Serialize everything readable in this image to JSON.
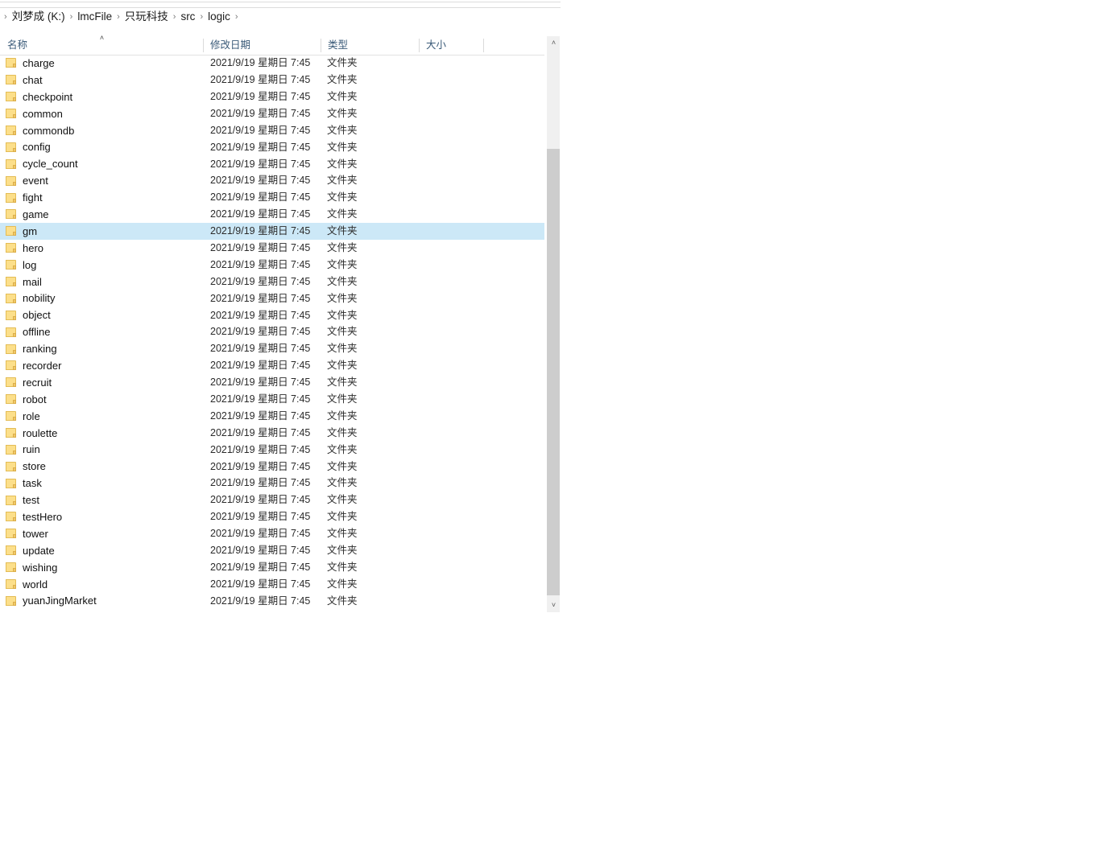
{
  "window": {
    "app": "File Explorer"
  },
  "addressbar": {
    "leading_separator": "›",
    "separator": "›",
    "crumbs": [
      "刘梦成 (K:)",
      "lmcFile",
      "只玩科技",
      "src",
      "logic"
    ]
  },
  "columns": {
    "sort_indicator": "˄",
    "headers": [
      {
        "label": "名称",
        "key": "name"
      },
      {
        "label": "修改日期",
        "key": "date"
      },
      {
        "label": "类型",
        "key": "type"
      },
      {
        "label": "大小",
        "key": "size"
      }
    ]
  },
  "colors": {
    "selection": "#cce8f7",
    "folder_fill": "#fcdf8a",
    "header_text": "#3a5a78"
  },
  "scrollbar": {
    "up_arrow": "˄",
    "down_arrow": "˅"
  },
  "rows": [
    {
      "name": "charge",
      "date": "2021/9/19 星期日 7:45",
      "type": "文件夹",
      "size": "",
      "selected": false
    },
    {
      "name": "chat",
      "date": "2021/9/19 星期日 7:45",
      "type": "文件夹",
      "size": "",
      "selected": false
    },
    {
      "name": "checkpoint",
      "date": "2021/9/19 星期日 7:45",
      "type": "文件夹",
      "size": "",
      "selected": false
    },
    {
      "name": "common",
      "date": "2021/9/19 星期日 7:45",
      "type": "文件夹",
      "size": "",
      "selected": false
    },
    {
      "name": "commondb",
      "date": "2021/9/19 星期日 7:45",
      "type": "文件夹",
      "size": "",
      "selected": false
    },
    {
      "name": "config",
      "date": "2021/9/19 星期日 7:45",
      "type": "文件夹",
      "size": "",
      "selected": false
    },
    {
      "name": "cycle_count",
      "date": "2021/9/19 星期日 7:45",
      "type": "文件夹",
      "size": "",
      "selected": false
    },
    {
      "name": "event",
      "date": "2021/9/19 星期日 7:45",
      "type": "文件夹",
      "size": "",
      "selected": false
    },
    {
      "name": "fight",
      "date": "2021/9/19 星期日 7:45",
      "type": "文件夹",
      "size": "",
      "selected": false
    },
    {
      "name": "game",
      "date": "2021/9/19 星期日 7:45",
      "type": "文件夹",
      "size": "",
      "selected": false
    },
    {
      "name": "gm",
      "date": "2021/9/19 星期日 7:45",
      "type": "文件夹",
      "size": "",
      "selected": true
    },
    {
      "name": "hero",
      "date": "2021/9/19 星期日 7:45",
      "type": "文件夹",
      "size": "",
      "selected": false
    },
    {
      "name": "log",
      "date": "2021/9/19 星期日 7:45",
      "type": "文件夹",
      "size": "",
      "selected": false
    },
    {
      "name": "mail",
      "date": "2021/9/19 星期日 7:45",
      "type": "文件夹",
      "size": "",
      "selected": false
    },
    {
      "name": "nobility",
      "date": "2021/9/19 星期日 7:45",
      "type": "文件夹",
      "size": "",
      "selected": false
    },
    {
      "name": "object",
      "date": "2021/9/19 星期日 7:45",
      "type": "文件夹",
      "size": "",
      "selected": false
    },
    {
      "name": "offline",
      "date": "2021/9/19 星期日 7:45",
      "type": "文件夹",
      "size": "",
      "selected": false
    },
    {
      "name": "ranking",
      "date": "2021/9/19 星期日 7:45",
      "type": "文件夹",
      "size": "",
      "selected": false
    },
    {
      "name": "recorder",
      "date": "2021/9/19 星期日 7:45",
      "type": "文件夹",
      "size": "",
      "selected": false
    },
    {
      "name": "recruit",
      "date": "2021/9/19 星期日 7:45",
      "type": "文件夹",
      "size": "",
      "selected": false
    },
    {
      "name": "robot",
      "date": "2021/9/19 星期日 7:45",
      "type": "文件夹",
      "size": "",
      "selected": false
    },
    {
      "name": "role",
      "date": "2021/9/19 星期日 7:45",
      "type": "文件夹",
      "size": "",
      "selected": false
    },
    {
      "name": "roulette",
      "date": "2021/9/19 星期日 7:45",
      "type": "文件夹",
      "size": "",
      "selected": false
    },
    {
      "name": "ruin",
      "date": "2021/9/19 星期日 7:45",
      "type": "文件夹",
      "size": "",
      "selected": false
    },
    {
      "name": "store",
      "date": "2021/9/19 星期日 7:45",
      "type": "文件夹",
      "size": "",
      "selected": false
    },
    {
      "name": "task",
      "date": "2021/9/19 星期日 7:45",
      "type": "文件夹",
      "size": "",
      "selected": false
    },
    {
      "name": "test",
      "date": "2021/9/19 星期日 7:45",
      "type": "文件夹",
      "size": "",
      "selected": false
    },
    {
      "name": "testHero",
      "date": "2021/9/19 星期日 7:45",
      "type": "文件夹",
      "size": "",
      "selected": false
    },
    {
      "name": "tower",
      "date": "2021/9/19 星期日 7:45",
      "type": "文件夹",
      "size": "",
      "selected": false
    },
    {
      "name": "update",
      "date": "2021/9/19 星期日 7:45",
      "type": "文件夹",
      "size": "",
      "selected": false
    },
    {
      "name": "wishing",
      "date": "2021/9/19 星期日 7:45",
      "type": "文件夹",
      "size": "",
      "selected": false
    },
    {
      "name": "world",
      "date": "2021/9/19 星期日 7:45",
      "type": "文件夹",
      "size": "",
      "selected": false
    },
    {
      "name": "yuanJingMarket",
      "date": "2021/9/19 星期日 7:45",
      "type": "文件夹",
      "size": "",
      "selected": false
    }
  ]
}
